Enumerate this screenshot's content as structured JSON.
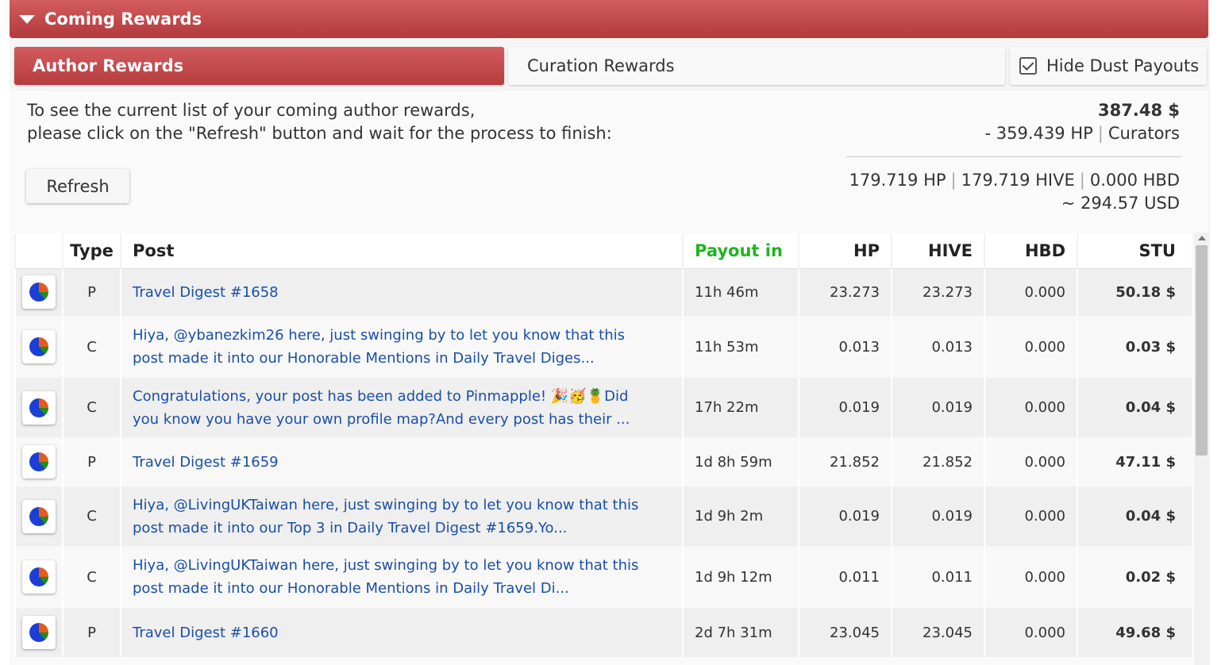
{
  "header": {
    "title": "Coming Rewards"
  },
  "tabs": {
    "author": "Author Rewards",
    "curation": "Curation Rewards",
    "hide_dust": "Hide Dust Payouts"
  },
  "intro": {
    "line1": "To see the current list of your coming author rewards,",
    "line2": "please click on the \"Refresh\" button and wait for the process to finish:"
  },
  "refresh_label": "Refresh",
  "summary": {
    "total_usd": "387.48 $",
    "curators_hp": "- 359.439 HP",
    "curators_label": "Curators",
    "hp": "179.719 HP",
    "hive": "179.719 HIVE",
    "hbd": "0.000 HBD",
    "usd": "~ 294.57 USD"
  },
  "table": {
    "columns": [
      "Type",
      "Post",
      "Payout in",
      "HP",
      "HIVE",
      "HBD",
      "STU"
    ],
    "rows": [
      {
        "type": "P",
        "post": "Travel Digest #1658",
        "payout": "11h 46m",
        "hp": "23.273",
        "hive": "23.273",
        "hbd": "0.000",
        "stu": "50.18 $"
      },
      {
        "type": "C",
        "post": "Hiya, @ybanezkim26 here, just swinging by to let you know that this post made it into our Honorable Mentions in Daily Travel Diges...",
        "payout": "11h 53m",
        "hp": "0.013",
        "hive": "0.013",
        "hbd": "0.000",
        "stu": "0.03 $"
      },
      {
        "type": "C",
        "post": "Congratulations, your post has been added to Pinmapple! 🎉🥳🍍Did you know you have your own profile map?And every post has their ...",
        "payout": "17h 22m",
        "hp": "0.019",
        "hive": "0.019",
        "hbd": "0.000",
        "stu": "0.04 $"
      },
      {
        "type": "P",
        "post": "Travel Digest #1659",
        "payout": "1d 8h 59m",
        "hp": "21.852",
        "hive": "21.852",
        "hbd": "0.000",
        "stu": "47.11 $"
      },
      {
        "type": "C",
        "post": "Hiya, @LivingUKTaiwan here, just swinging by to let you know that this post made it into our Top 3 in Daily Travel Digest #1659.Yo...",
        "payout": "1d 9h 2m",
        "hp": "0.019",
        "hive": "0.019",
        "hbd": "0.000",
        "stu": "0.04 $"
      },
      {
        "type": "C",
        "post": "Hiya, @LivingUKTaiwan here, just swinging by to let you know that this post made it into our Honorable Mentions in Daily Travel Di...",
        "payout": "1d 9h 12m",
        "hp": "0.011",
        "hive": "0.011",
        "hbd": "0.000",
        "stu": "0.02 $"
      },
      {
        "type": "P",
        "post": "Travel Digest #1660",
        "payout": "2d 7h 31m",
        "hp": "23.045",
        "hive": "23.045",
        "hbd": "0.000",
        "stu": "49.68 $"
      }
    ]
  }
}
